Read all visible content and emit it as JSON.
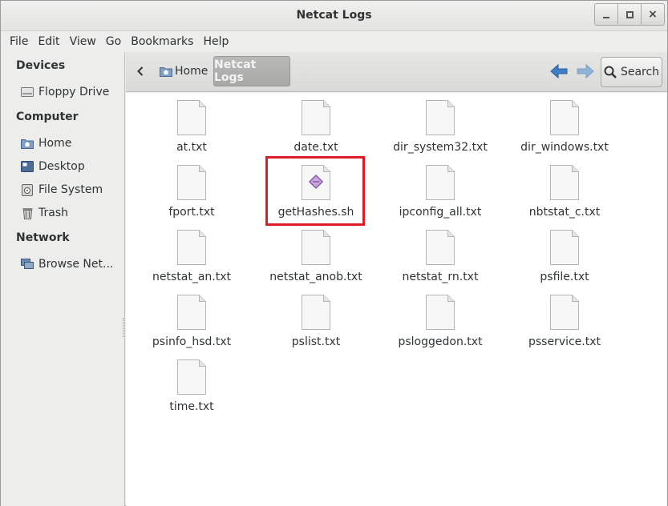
{
  "window": {
    "title": "Netcat Logs",
    "controls": {
      "minimize": "_",
      "maximize": "□",
      "close": "×"
    }
  },
  "menubar": {
    "items": [
      "File",
      "Edit",
      "View",
      "Go",
      "Bookmarks",
      "Help"
    ]
  },
  "sidebar": {
    "sections": [
      {
        "heading": "Devices",
        "items": [
          {
            "label": "Floppy Drive",
            "icon": "floppy-drive-icon"
          }
        ]
      },
      {
        "heading": "Computer",
        "items": [
          {
            "label": "Home",
            "icon": "home-folder-icon"
          },
          {
            "label": "Desktop",
            "icon": "desktop-icon"
          },
          {
            "label": "File System",
            "icon": "file-system-icon"
          },
          {
            "label": "Trash",
            "icon": "trash-icon"
          }
        ]
      },
      {
        "heading": "Network",
        "items": [
          {
            "label": "Browse Net...",
            "icon": "network-icon"
          }
        ]
      }
    ]
  },
  "toolbar": {
    "back_icon": "chevron-left-icon",
    "breadcrumb_home": "Home",
    "breadcrumb_current": "Netcat Logs",
    "search_label": "Search",
    "colors": {
      "nav_back_arrow": "#3d7fc4",
      "nav_forward_arrow": "#8fb3d9"
    }
  },
  "files": [
    {
      "name": "at.txt",
      "type": "text"
    },
    {
      "name": "date.txt",
      "type": "text"
    },
    {
      "name": "dir_system32.txt",
      "type": "text"
    },
    {
      "name": "dir_windows.txt",
      "type": "text"
    },
    {
      "name": "fport.txt",
      "type": "text"
    },
    {
      "name": "getHashes.sh",
      "type": "script",
      "highlighted": true
    },
    {
      "name": "ipconfig_all.txt",
      "type": "text"
    },
    {
      "name": "nbtstat_c.txt",
      "type": "text"
    },
    {
      "name": "netstat_an.txt",
      "type": "text"
    },
    {
      "name": "netstat_anob.txt",
      "type": "text"
    },
    {
      "name": "netstat_rn.txt",
      "type": "text"
    },
    {
      "name": "psfile.txt",
      "type": "text"
    },
    {
      "name": "psinfo_hsd.txt",
      "type": "text"
    },
    {
      "name": "pslist.txt",
      "type": "text"
    },
    {
      "name": "psloggedon.txt",
      "type": "text"
    },
    {
      "name": "psservice.txt",
      "type": "text"
    },
    {
      "name": "time.txt",
      "type": "text"
    }
  ],
  "colors": {
    "highlight_box": "#e01b24",
    "script_icon": "#8a5aa8"
  }
}
